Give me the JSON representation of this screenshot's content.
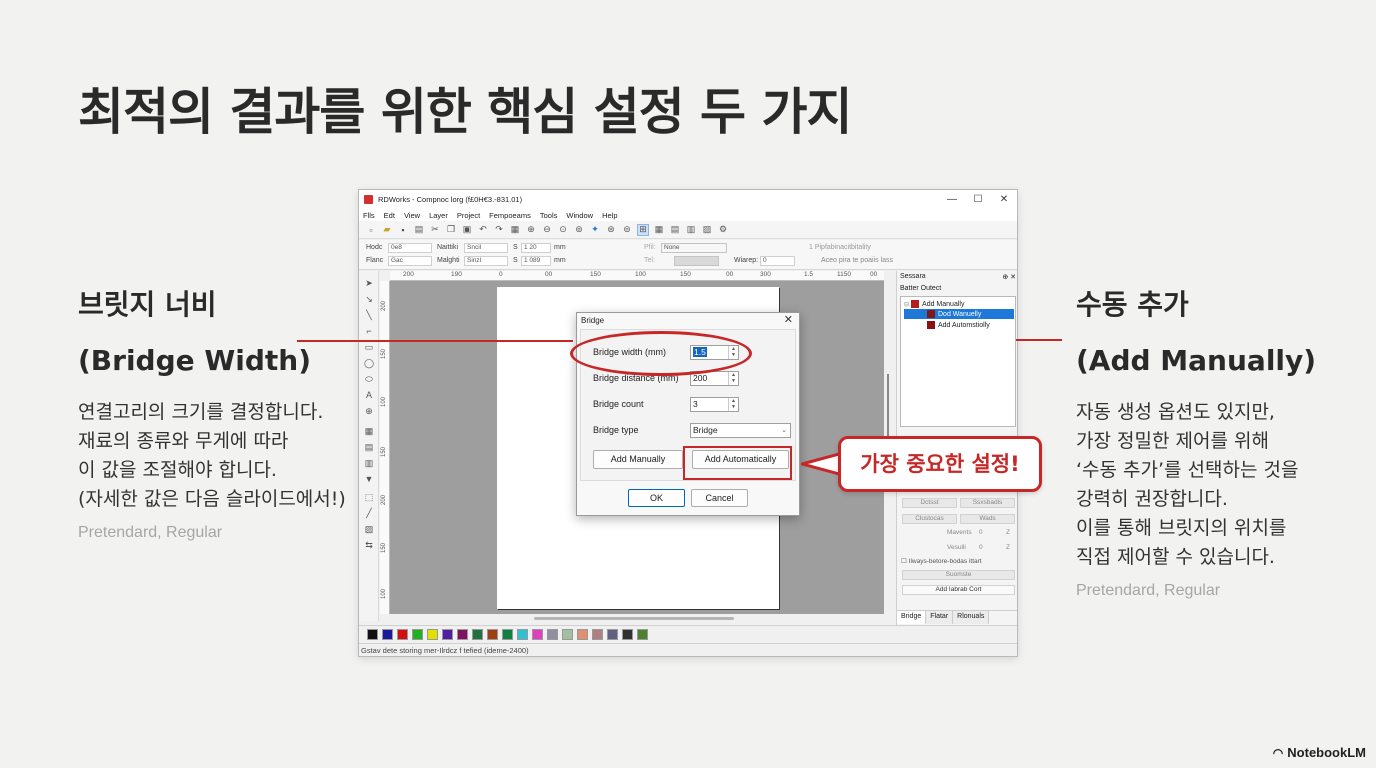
{
  "slide": {
    "title": "최적의 결과를 위한 핵심 설정 두 가지",
    "left": {
      "heading_ko": "브릿지 너비",
      "heading_en": "(Bridge Width)",
      "body": [
        "연결고리의 크기를 결정합니다.",
        "재료의 종류와 무게에 따라",
        "이 값을 조절해야 합니다.",
        "(자세한 값은 다음 슬라이드에서!)"
      ],
      "font_note": "Pretendard, Regular"
    },
    "right": {
      "heading_ko": "수동 추가",
      "heading_en": "(Add Manually)",
      "body": [
        "자동 생성 옵션도 있지만,",
        "가장 정밀한 제어를 위해",
        "‘수동 추가’를 선택하는 것을",
        "강력히 권장합니다.",
        "이를 통해 브릿지의 위치를",
        "직접 제어할 수 있습니다."
      ],
      "font_note": "Pretendard, Regular"
    },
    "callout": "가장 중요한 설정!",
    "brand": "NotebookLM",
    "accent_color": "#c62828"
  },
  "app": {
    "title": "RDWorks - Compnoc lorg (f£0H€3.-831.01)",
    "menu": [
      "Flls",
      "Edt",
      "View",
      "Layer",
      "Project",
      "Fempoeams",
      "Tools",
      "Window",
      "Help"
    ],
    "props": {
      "row1": [
        "Hodc",
        "0e8",
        "Naittiki",
        "Sncil",
        "S",
        "1 20",
        "mm",
        "Pfil:",
        "None",
        "1 Pipfabinacitbitality"
      ],
      "row2": [
        "Flanc",
        "Gac",
        "Malghti",
        "Sinzl",
        "S",
        "1 089",
        "mm",
        "Tel:",
        "Wiarep:",
        "0",
        "Aceo pira te poaiis lass"
      ]
    },
    "ruler_h": [
      "200",
      "190",
      "0",
      "00",
      "150",
      "100",
      "150",
      "00",
      "300",
      "1.5",
      "1150",
      "00"
    ],
    "ruler_v": [
      "200",
      "150",
      "100",
      "150",
      "200",
      "150",
      "100"
    ],
    "panel": {
      "header": "Sessara",
      "pin": "⊕ ✕",
      "sub": "Batter Outect",
      "tree": [
        "Add Manually",
        "Dod Wanuelly",
        "Add Automstiolly"
      ],
      "buttons": [
        "Dctsst",
        "Ssxsbadls",
        "Clustocas",
        "Wads",
        "Suomste",
        "Add Iabrab Cort"
      ],
      "labels": [
        "Mavents",
        "0",
        "Z",
        "Vesulli",
        "0",
        "Z"
      ],
      "checkbox_label": "Ilways-betore-bodas ittart",
      "tabs": [
        "Bridge",
        "Flatar",
        "Rlonuals"
      ]
    },
    "palette": [
      "#111111",
      "#1a1a9a",
      "#d01010",
      "#20b020",
      "#e0e000",
      "#5020a0",
      "#801060",
      "#207040",
      "#a04010",
      "#108040",
      "#30c0d0",
      "#e040c0",
      "#9090a0",
      "#a0c0a0",
      "#e09070",
      "#b08080",
      "#606080",
      "#303030",
      "#508030"
    ],
    "status": "Gstav dete storing mer-Ilrdcz f tefied (ideme-2400)",
    "dialog": {
      "title": "Bridge",
      "close": "✕",
      "width_label": "Bridge width (mm)",
      "width_value": "1.5",
      "distance_label": "Bridge distance (mm)",
      "distance_value": "200",
      "count_label": "Bridge count",
      "count_value": "3",
      "type_label": "Bridge type",
      "type_value": "Bridge",
      "add_manually": "Add Manually",
      "add_automatically": "Add Automatically",
      "ok": "OK",
      "cancel": "Cancel"
    }
  }
}
